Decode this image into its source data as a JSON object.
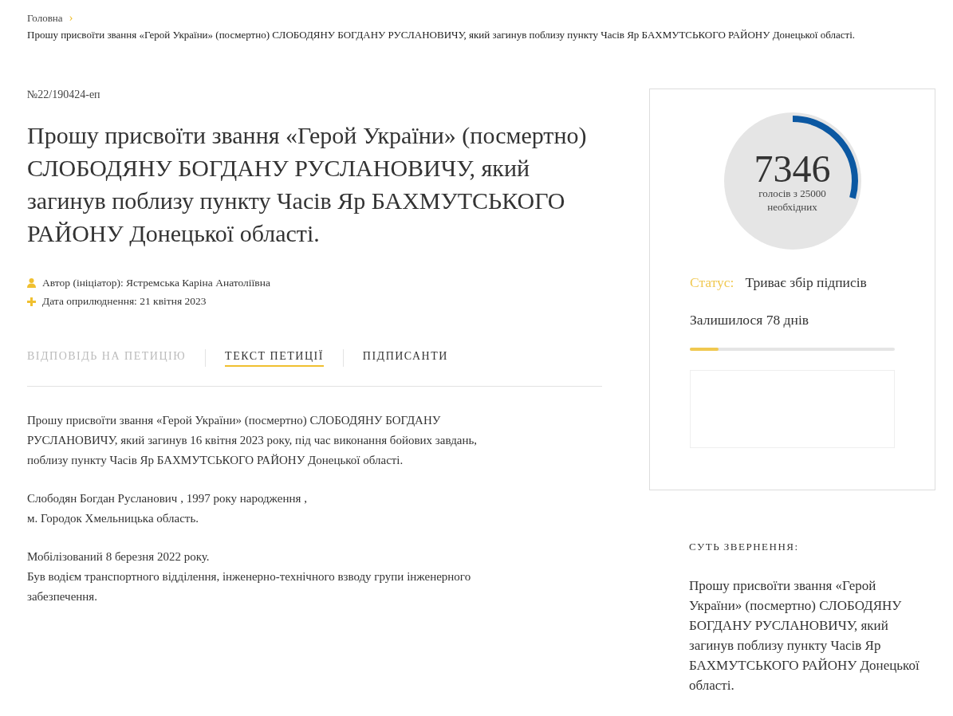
{
  "breadcrumb": {
    "home": "Головна",
    "separator": "›",
    "current": "Прошу присвоїти звання «Герой України» (посмертно) СЛОБОДЯНУ БОГДАНУ РУСЛАНОВИЧУ, який загинув поблизу пункту Часів Яр БАХМУТСЬКОГО РАЙОНУ Донецької області."
  },
  "petition": {
    "number": "№22/190424-еп",
    "title": "Прошу присвоїти звання «Герой України» (посмертно) СЛОБОДЯНУ БОГДАНУ РУСЛАНОВИЧУ, який загинув поблизу пункту Часів Яр БАХМУТСЬКОГО РАЙОНУ Донецької області.",
    "meta": [
      {
        "kind": "author",
        "text": "Автор (ініціатор): Ястремська Каріна Анатоліївна"
      },
      {
        "kind": "date",
        "text": "Дата оприлюднення: 21 квітня 2023"
      }
    ]
  },
  "tabs": [
    {
      "label": "ВІДПОВІДЬ НА ПЕТИЦІЮ",
      "selected": false,
      "disabled": true
    },
    {
      "label": "ТЕКСТ ПЕТИЦІЇ",
      "selected": true,
      "disabled": false
    },
    {
      "label": "ПІДПИСАНТИ",
      "selected": false,
      "disabled": false
    }
  ],
  "body": [
    [
      "Прошу присвоїти звання «Герой України» (посмертно) СЛОБОДЯНУ БОГДАНУ",
      "РУСЛАНОВИЧУ, який загинув 16 квітня 2023 року, під час виконання бойових завдань,",
      "поблизу пункту Часів Яр БАХМУТСЬКОГО РАЙОНУ Донецької області."
    ],
    [
      "Слободян Богдан Русланович , 1997 року народження ,",
      "м. Городок Хмельницька область."
    ],
    [
      "Мобілізований 8 березня 2022 року.",
      "Був водієм транспортного відділення, інженерно-технічного взводу групи інженерного",
      "забезпечення."
    ]
  ],
  "votes": {
    "count": "7346",
    "caption": "голосів з 25000 необхідних",
    "level": 0.294
  },
  "status": {
    "label": "Статус:",
    "value": "Триває збір підписів"
  },
  "remaining": {
    "text": "Залишилося 78 днів",
    "level": 0.14
  },
  "summary": {
    "heading": "СУТЬ ЗВЕРНЕННЯ:",
    "text": "Прошу присвоїти звання «Герой України» (посмертно) СЛОБОДЯНУ БОГДАНУ РУСЛАНОВИЧУ, який загинув поблизу пункту Часів Яр БАХМУТСЬКОГО РАЙОНУ Донецької області."
  }
}
